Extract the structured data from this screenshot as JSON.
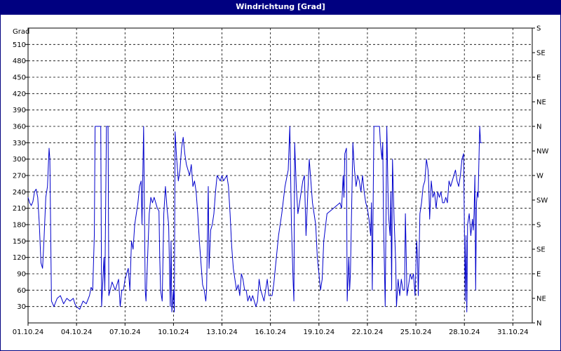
{
  "window": {
    "title": "Windrichtung [Grad]"
  },
  "chart_data": {
    "type": "line",
    "title": "Windrichtung [Grad]",
    "ylabel": "Grad",
    "ylim": [
      0,
      540
    ],
    "yticks": [
      30,
      60,
      90,
      120,
      150,
      180,
      210,
      240,
      270,
      300,
      330,
      360,
      390,
      420,
      450,
      480,
      510
    ],
    "right_ticks": [
      {
        "value": 0,
        "label": "N"
      },
      {
        "value": 45,
        "label": "NE"
      },
      {
        "value": 90,
        "label": "E"
      },
      {
        "value": 135,
        "label": "SE"
      },
      {
        "value": 180,
        "label": "S"
      },
      {
        "value": 225,
        "label": "SW"
      },
      {
        "value": 270,
        "label": "W"
      },
      {
        "value": 315,
        "label": "NW"
      },
      {
        "value": 360,
        "label": "N"
      },
      {
        "value": 405,
        "label": "NE"
      },
      {
        "value": 450,
        "label": "E"
      },
      {
        "value": 495,
        "label": "SE"
      },
      {
        "value": 540,
        "label": "S"
      }
    ],
    "x_tick_labels": [
      "01.10.24",
      "04.10.24",
      "07.10.24",
      "10.10.24",
      "13.10.24",
      "16.10.24",
      "19.10.24",
      "22.10.24",
      "25.10.24",
      "28.10.24",
      "31.10.24"
    ],
    "x_range_days": [
      0,
      31.2
    ],
    "grid": true,
    "series": [
      {
        "color": "#0000cc",
        "points": [
          [
            0.0,
            230
          ],
          [
            0.1,
            220
          ],
          [
            0.2,
            215
          ],
          [
            0.3,
            222
          ],
          [
            0.4,
            240
          ],
          [
            0.5,
            245
          ],
          [
            0.6,
            230
          ],
          [
            0.7,
            180
          ],
          [
            0.8,
            110
          ],
          [
            0.9,
            100
          ],
          [
            1.0,
            160
          ],
          [
            1.1,
            230
          ],
          [
            1.2,
            250
          ],
          [
            1.3,
            320
          ],
          [
            1.35,
            300
          ],
          [
            1.45,
            40
          ],
          [
            1.6,
            30
          ],
          [
            1.8,
            45
          ],
          [
            2.0,
            50
          ],
          [
            2.2,
            35
          ],
          [
            2.4,
            45
          ],
          [
            2.6,
            40
          ],
          [
            2.8,
            45
          ],
          [
            2.9,
            35
          ],
          [
            3.0,
            30
          ],
          [
            3.2,
            25
          ],
          [
            3.4,
            40
          ],
          [
            3.6,
            35
          ],
          [
            3.8,
            50
          ],
          [
            3.9,
            65
          ],
          [
            4.0,
            60
          ],
          [
            4.1,
            160
          ],
          [
            4.15,
            360
          ],
          [
            4.4,
            360
          ],
          [
            4.5,
            360
          ],
          [
            4.55,
            30
          ],
          [
            4.7,
            120
          ],
          [
            4.75,
            60
          ],
          [
            4.85,
            360
          ],
          [
            4.95,
            360
          ],
          [
            5.0,
            50
          ],
          [
            5.2,
            75
          ],
          [
            5.4,
            60
          ],
          [
            5.6,
            80
          ],
          [
            5.7,
            30
          ],
          [
            5.8,
            60
          ],
          [
            5.9,
            60
          ],
          [
            6.0,
            80
          ],
          [
            6.2,
            100
          ],
          [
            6.3,
            60
          ],
          [
            6.4,
            150
          ],
          [
            6.5,
            135
          ],
          [
            6.6,
            180
          ],
          [
            6.8,
            220
          ],
          [
            6.9,
            250
          ],
          [
            7.0,
            260
          ],
          [
            7.05,
            180
          ],
          [
            7.15,
            360
          ],
          [
            7.25,
            60
          ],
          [
            7.3,
            40
          ],
          [
            7.5,
            200
          ],
          [
            7.6,
            230
          ],
          [
            7.7,
            220
          ],
          [
            7.8,
            230
          ],
          [
            7.9,
            220
          ],
          [
            8.0,
            210
          ],
          [
            8.1,
            205
          ],
          [
            8.15,
            120
          ],
          [
            8.2,
            60
          ],
          [
            8.3,
            40
          ],
          [
            8.4,
            200
          ],
          [
            8.5,
            250
          ],
          [
            8.6,
            210
          ],
          [
            8.7,
            180
          ],
          [
            8.8,
            30
          ],
          [
            8.85,
            150
          ],
          [
            8.9,
            20
          ],
          [
            9.0,
            60
          ],
          [
            9.05,
            20
          ],
          [
            9.1,
            350
          ],
          [
            9.2,
            300
          ],
          [
            9.3,
            260
          ],
          [
            9.4,
            280
          ],
          [
            9.5,
            320
          ],
          [
            9.6,
            340
          ],
          [
            9.7,
            310
          ],
          [
            9.8,
            290
          ],
          [
            9.9,
            280
          ],
          [
            10.0,
            270
          ],
          [
            10.1,
            290
          ],
          [
            10.2,
            250
          ],
          [
            10.3,
            260
          ],
          [
            10.4,
            240
          ],
          [
            10.5,
            200
          ],
          [
            10.6,
            150
          ],
          [
            10.7,
            110
          ],
          [
            10.8,
            70
          ],
          [
            10.9,
            60
          ],
          [
            11.0,
            40
          ],
          [
            11.05,
            60
          ],
          [
            11.15,
            250
          ],
          [
            11.2,
            100
          ],
          [
            11.3,
            170
          ],
          [
            11.4,
            180
          ],
          [
            11.5,
            200
          ],
          [
            11.6,
            240
          ],
          [
            11.7,
            270
          ],
          [
            11.8,
            265
          ],
          [
            11.9,
            260
          ],
          [
            12.0,
            270
          ],
          [
            12.1,
            260
          ],
          [
            12.2,
            265
          ],
          [
            12.3,
            270
          ],
          [
            12.4,
            250
          ],
          [
            12.5,
            200
          ],
          [
            12.6,
            140
          ],
          [
            12.7,
            100
          ],
          [
            12.8,
            80
          ],
          [
            12.9,
            60
          ],
          [
            13.0,
            70
          ],
          [
            13.1,
            50
          ],
          [
            13.2,
            90
          ],
          [
            13.3,
            80
          ],
          [
            13.4,
            60
          ],
          [
            13.5,
            60
          ],
          [
            13.6,
            40
          ],
          [
            13.7,
            50
          ],
          [
            13.8,
            40
          ],
          [
            13.9,
            50
          ],
          [
            14.0,
            40
          ],
          [
            14.1,
            30
          ],
          [
            14.2,
            40
          ],
          [
            14.3,
            80
          ],
          [
            14.4,
            60
          ],
          [
            14.5,
            50
          ],
          [
            14.6,
            40
          ],
          [
            14.7,
            60
          ],
          [
            14.8,
            80
          ],
          [
            14.9,
            50
          ],
          [
            15.0,
            50
          ],
          [
            15.1,
            50
          ],
          [
            15.2,
            70
          ],
          [
            15.3,
            100
          ],
          [
            15.5,
            160
          ],
          [
            15.7,
            200
          ],
          [
            15.9,
            250
          ],
          [
            16.1,
            280
          ],
          [
            16.2,
            360
          ],
          [
            16.3,
            180
          ],
          [
            16.4,
            80
          ],
          [
            16.45,
            40
          ],
          [
            16.5,
            330
          ],
          [
            16.6,
            250
          ],
          [
            16.7,
            200
          ],
          [
            16.8,
            220
          ],
          [
            16.9,
            240
          ],
          [
            17.0,
            260
          ],
          [
            17.1,
            270
          ],
          [
            17.2,
            160
          ],
          [
            17.3,
            230
          ],
          [
            17.4,
            300
          ],
          [
            17.5,
            260
          ],
          [
            17.6,
            220
          ],
          [
            17.8,
            180
          ],
          [
            17.9,
            120
          ],
          [
            18.0,
            90
          ],
          [
            18.1,
            60
          ],
          [
            18.2,
            80
          ],
          [
            18.3,
            150
          ],
          [
            18.5,
            200
          ],
          [
            18.7,
            205
          ],
          [
            18.9,
            210
          ],
          [
            19.1,
            215
          ],
          [
            19.3,
            220
          ],
          [
            19.4,
            210
          ],
          [
            19.5,
            270
          ],
          [
            19.55,
            230
          ],
          [
            19.6,
            310
          ],
          [
            19.7,
            320
          ],
          [
            19.75,
            40
          ],
          [
            19.85,
            120
          ],
          [
            19.9,
            60
          ],
          [
            19.95,
            90
          ],
          [
            20.1,
            330
          ],
          [
            20.2,
            280
          ],
          [
            20.3,
            250
          ],
          [
            20.4,
            270
          ],
          [
            20.5,
            260
          ],
          [
            20.6,
            240
          ],
          [
            20.7,
            270
          ],
          [
            20.8,
            240
          ],
          [
            20.9,
            220
          ],
          [
            21.0,
            210
          ],
          [
            21.1,
            190
          ],
          [
            21.2,
            160
          ],
          [
            21.25,
            220
          ],
          [
            21.3,
            60
          ],
          [
            21.4,
            360
          ],
          [
            21.5,
            360
          ],
          [
            21.55,
            360
          ],
          [
            21.6,
            360
          ],
          [
            21.7,
            360
          ],
          [
            21.75,
            360
          ],
          [
            21.8,
            330
          ],
          [
            21.9,
            300
          ],
          [
            21.95,
            330
          ],
          [
            22.0,
            180
          ],
          [
            22.1,
            30
          ],
          [
            22.2,
            360
          ],
          [
            22.3,
            200
          ],
          [
            22.4,
            160
          ],
          [
            22.45,
            240
          ],
          [
            22.5,
            60
          ],
          [
            22.55,
            300
          ],
          [
            22.65,
            190
          ],
          [
            22.75,
            110
          ],
          [
            22.8,
            30
          ],
          [
            22.9,
            80
          ],
          [
            23.0,
            50
          ],
          [
            23.1,
            80
          ],
          [
            23.2,
            60
          ],
          [
            23.3,
            60
          ],
          [
            23.35,
            200
          ],
          [
            23.45,
            50
          ],
          [
            23.55,
            70
          ],
          [
            23.65,
            90
          ],
          [
            23.75,
            80
          ],
          [
            23.85,
            90
          ],
          [
            23.95,
            50
          ],
          [
            24.05,
            150
          ],
          [
            24.1,
            120
          ],
          [
            24.15,
            50
          ],
          [
            24.25,
            200
          ],
          [
            24.35,
            220
          ],
          [
            24.45,
            250
          ],
          [
            24.55,
            260
          ],
          [
            24.65,
            300
          ],
          [
            24.75,
            280
          ],
          [
            24.8,
            250
          ],
          [
            24.85,
            190
          ],
          [
            24.95,
            260
          ],
          [
            25.05,
            230
          ],
          [
            25.15,
            240
          ],
          [
            25.25,
            210
          ],
          [
            25.35,
            240
          ],
          [
            25.45,
            230
          ],
          [
            25.55,
            240
          ],
          [
            25.65,
            220
          ],
          [
            25.75,
            220
          ],
          [
            25.85,
            230
          ],
          [
            25.95,
            220
          ],
          [
            26.05,
            260
          ],
          [
            26.15,
            250
          ],
          [
            26.25,
            260
          ],
          [
            26.35,
            270
          ],
          [
            26.45,
            280
          ],
          [
            26.55,
            260
          ],
          [
            26.65,
            250
          ],
          [
            26.75,
            270
          ],
          [
            26.85,
            300
          ],
          [
            26.95,
            310
          ],
          [
            27.0,
            180
          ],
          [
            27.05,
            40
          ],
          [
            27.1,
            160
          ],
          [
            27.15,
            20
          ],
          [
            27.2,
            180
          ],
          [
            27.3,
            200
          ],
          [
            27.4,
            160
          ],
          [
            27.5,
            190
          ],
          [
            27.55,
            170
          ],
          [
            27.6,
            200
          ],
          [
            27.65,
            270
          ],
          [
            27.7,
            60
          ],
          [
            27.75,
            220
          ],
          [
            27.8,
            240
          ],
          [
            27.85,
            230
          ],
          [
            27.9,
            300
          ],
          [
            27.95,
            360
          ],
          [
            28.0,
            330
          ],
          [
            28.1,
            330
          ]
        ]
      }
    ]
  }
}
